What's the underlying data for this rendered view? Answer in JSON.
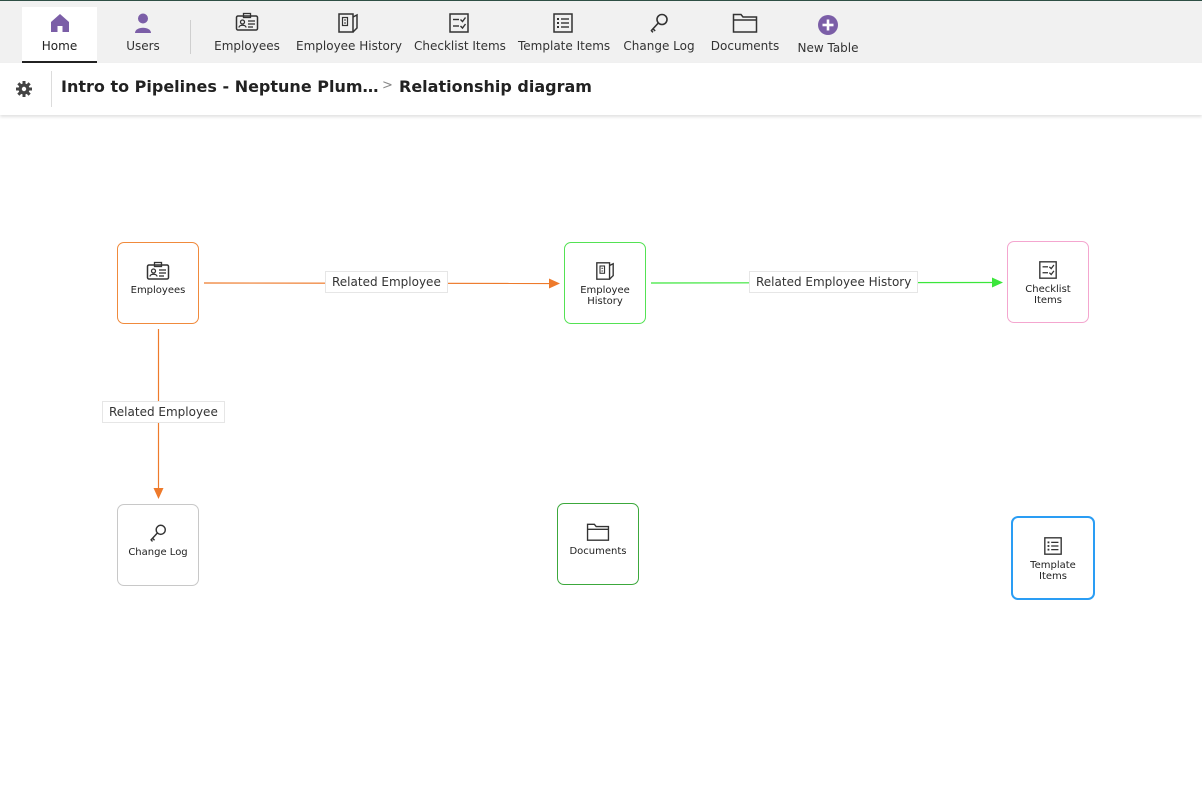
{
  "toolbar": {
    "tabs": [
      {
        "label": "Home",
        "icon": "home-icon"
      },
      {
        "label": "Users",
        "icon": "user-icon"
      },
      {
        "label": "Employees",
        "icon": "id-card-icon"
      },
      {
        "label": "Employee History",
        "icon": "document-history-icon"
      },
      {
        "label": "Checklist Items",
        "icon": "checklist-icon"
      },
      {
        "label": "Template Items",
        "icon": "list-icon"
      },
      {
        "label": "Change Log",
        "icon": "key-icon"
      },
      {
        "label": "Documents",
        "icon": "folder-icon"
      },
      {
        "label": "New Table",
        "icon": "plus-circle-icon"
      }
    ],
    "accent": "#7b5ea7"
  },
  "breadcrumb": {
    "project": "Intro to Pipelines - Neptune Plumbing",
    "chevron": ">",
    "page": "Relationship diagram"
  },
  "diagram": {
    "nodes": {
      "employees": {
        "label": "Employees",
        "color": "#f08a3c"
      },
      "employee_history": {
        "label": "Employee History",
        "color": "#54e254"
      },
      "checklist_items": {
        "label": "Checklist Items",
        "color": "#f4a6cf"
      },
      "change_log": {
        "label": "Change Log",
        "color": "#c8c8c8"
      },
      "documents": {
        "label": "Documents",
        "color": "#3ca83c"
      },
      "template_items": {
        "label": "Template Items",
        "color": "#2a9df4"
      }
    },
    "edges": {
      "emp_to_hist": {
        "label": "Related Employee",
        "color": "#ee7a2b"
      },
      "hist_to_check": {
        "label": "Related Employee History",
        "color": "#3be63b"
      },
      "emp_to_log": {
        "label": "Related Employee",
        "color": "#ee7a2b"
      }
    }
  }
}
